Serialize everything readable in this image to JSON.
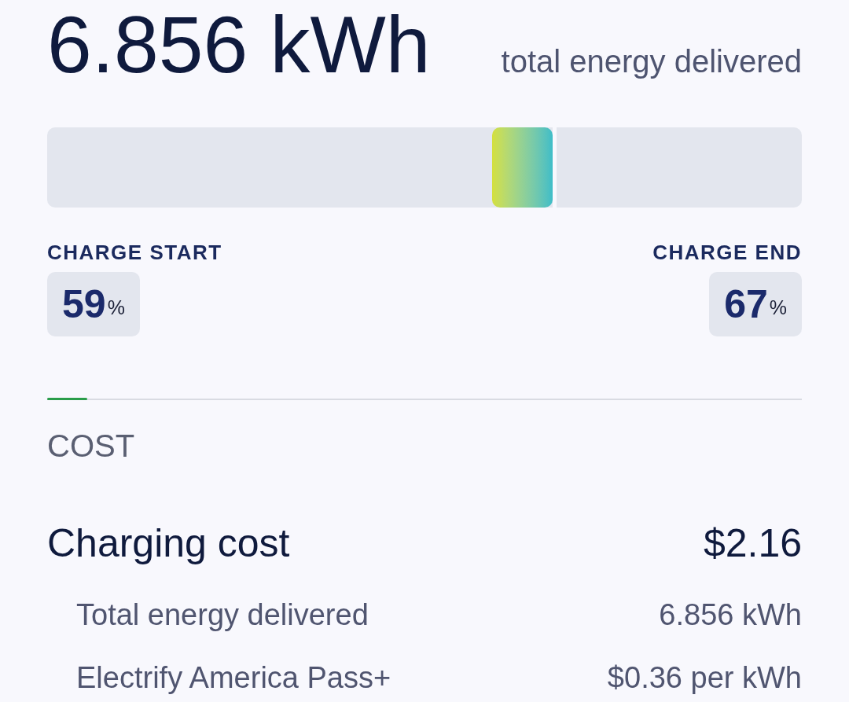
{
  "summary": {
    "value": "6.856 kWh",
    "caption": "total energy delivered"
  },
  "charge_bar": {
    "start": {
      "level": 0.59
    },
    "end": {
      "level": 0.67
    }
  },
  "charge_start": {
    "label": "CHARGE START",
    "value": "59",
    "unit": "%"
  },
  "charge_end": {
    "label": "CHARGE END",
    "value": "67",
    "unit": "%"
  },
  "cost": {
    "heading": "COST",
    "total": {
      "label": "Charging cost",
      "value": "$2.16"
    },
    "details": [
      {
        "label": "Total energy delivered",
        "value": "6.856 kWh"
      },
      {
        "label": "Electrify America Pass+",
        "value": "$0.36 per kWh"
      }
    ]
  }
}
